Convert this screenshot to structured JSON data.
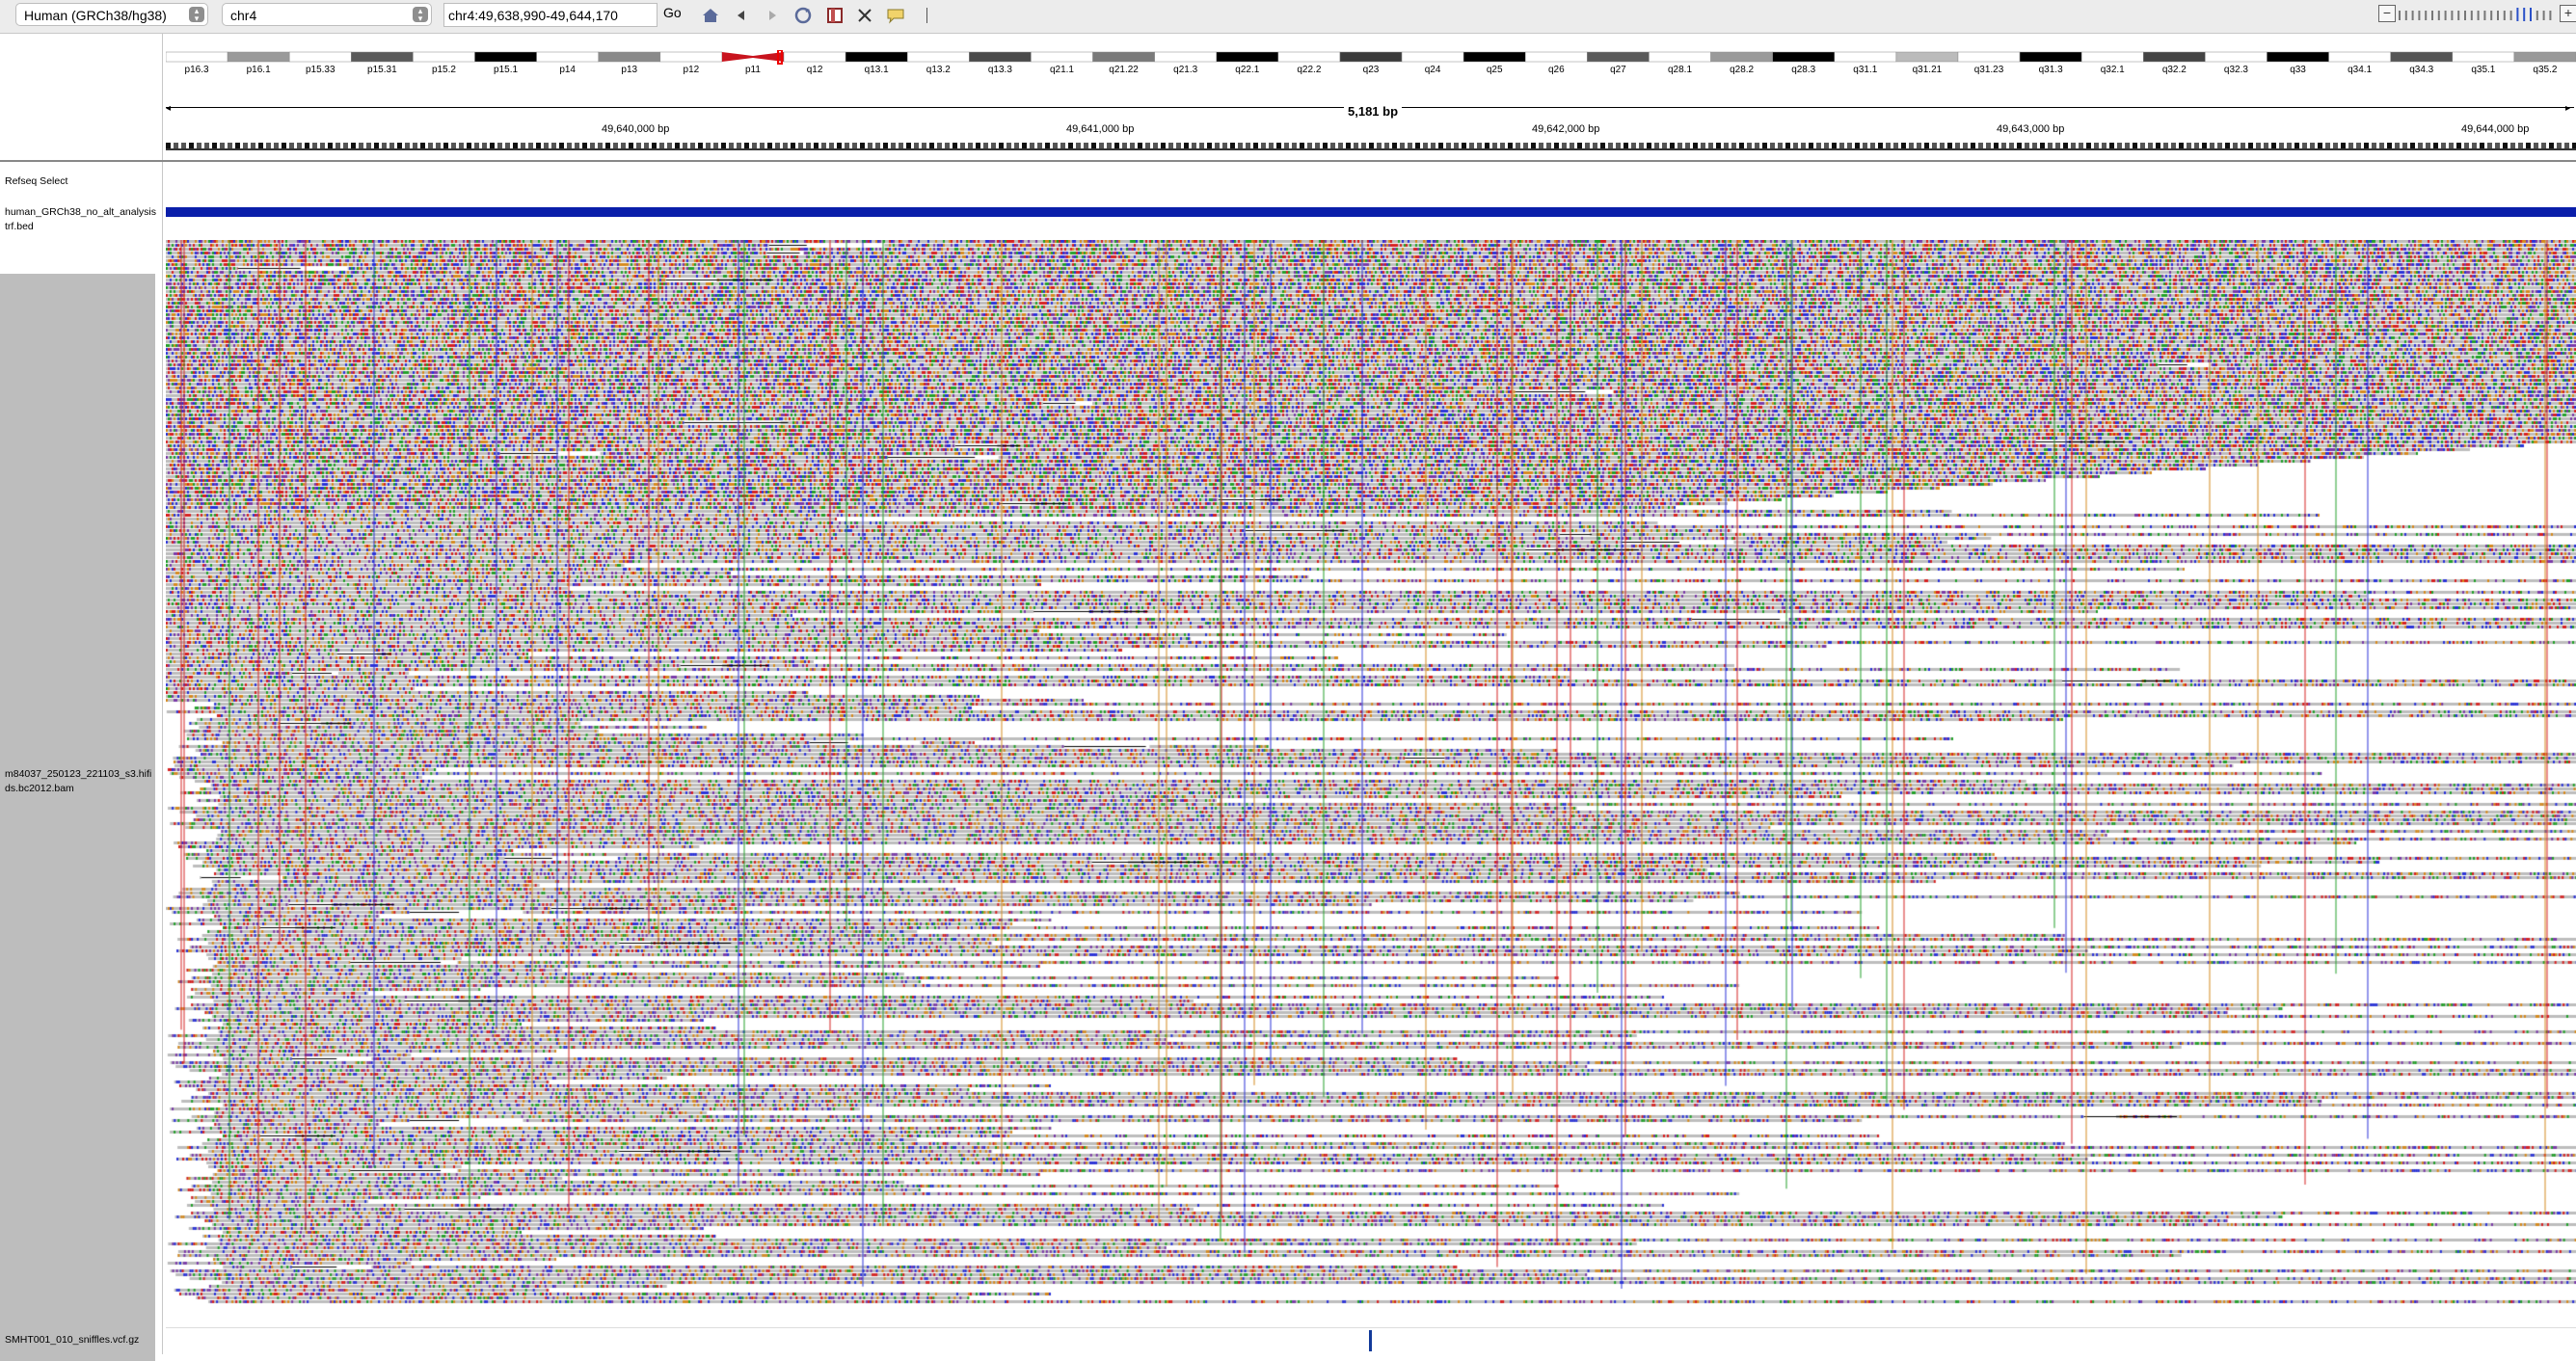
{
  "toolbar": {
    "genome": "Human (GRCh38/hg38)",
    "chromosome": "chr4",
    "locus": "chr4:49,638,990-49,644,170",
    "go_label": "Go"
  },
  "ideogram": {
    "bands": [
      "p16.3",
      "p16.1",
      "p15.33",
      "p15.31",
      "p15.2",
      "p15.1",
      "p14",
      "p13",
      "p12",
      "p11",
      "q12",
      "q13.1",
      "q13.2",
      "q13.3",
      "q21.1",
      "q21.22",
      "q21.3",
      "q22.1",
      "q22.2",
      "q23",
      "q24",
      "q25",
      "q26",
      "q27",
      "q28.1",
      "q28.2",
      "q28.3",
      "q31.1",
      "q31.21",
      "q31.23",
      "q31.3",
      "q32.1",
      "q32.2",
      "q32.3",
      "q33",
      "q34.1",
      "q34.3",
      "q35.1",
      "q35.2"
    ]
  },
  "ruler": {
    "span": "5,181 bp",
    "ticks": [
      "49,640,000 bp",
      "49,641,000 bp",
      "49,642,000 bp",
      "49,643,000 bp",
      "49,644,000 bp"
    ]
  },
  "tracks": {
    "refseq": "Refseq Select",
    "bed_line1": "human_GRCh38_no_alt_analysis",
    "bed_line2": "trf.bed",
    "bam_line1": "m84037_250123_221103_s3.hifi",
    "bam_line2": "ds.bc2012.bam",
    "vcf": "SMHT001_010_sniffles.vcf.gz"
  },
  "colors": {
    "bed": "#0a1eaa",
    "read_grey": "#bdbdbd",
    "base_a": "#22a02a",
    "base_c": "#2a32d8",
    "base_g": "#d68a1e",
    "base_t": "#d62020",
    "centromere": "#c8141e"
  },
  "icons": [
    "home-icon",
    "back-icon",
    "forward-icon",
    "refresh-icon",
    "roi-icon",
    "crosshair-icon",
    "popup-icon"
  ]
}
